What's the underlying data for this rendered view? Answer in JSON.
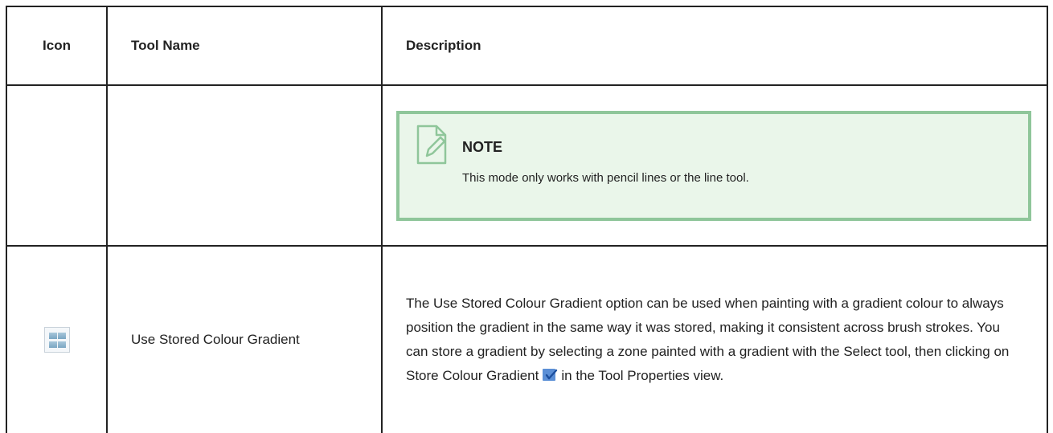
{
  "table": {
    "headers": {
      "icon": "Icon",
      "name": "Tool Name",
      "description": "Description"
    },
    "note": {
      "title": "NOTE",
      "text": "This mode only works with pencil lines or the line tool."
    },
    "rows": [
      {
        "icon": "use-stored-colour-gradient-icon",
        "name": "Use Stored Colour Gradient",
        "description_before": "The Use Stored Colour Gradient option can be used when painting with a gradient colour to always position the gradient in the same way it was stored, making it consistent across brush strokes. You can store a gradient by selecting a zone painted with a gradient with the Select tool, then clicking on Store Colour Gradient",
        "inline_icon": "store-colour-gradient-icon",
        "description_after": "in the Tool Properties view."
      }
    ]
  },
  "colors": {
    "note_border": "#8fc69a",
    "note_background": "#eaf6ea",
    "table_border": "#222222"
  }
}
